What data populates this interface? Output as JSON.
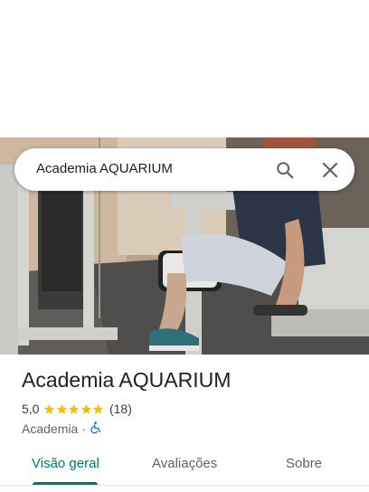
{
  "search": {
    "query": "Academia AQUARIUM"
  },
  "place": {
    "name": "Academia AQUARIUM",
    "rating": "5,0",
    "stars": 5,
    "review_count": "(18)",
    "category": "Academia",
    "separator": "·",
    "wheelchair_accessible": true
  },
  "tabs": [
    {
      "label": "Visão geral",
      "active": true
    },
    {
      "label": "Avaliações",
      "active": false
    },
    {
      "label": "Sobre",
      "active": false
    }
  ],
  "colors": {
    "accent": "#00796b",
    "star": "#fbbc04",
    "accessibility_icon": "#1a73e8"
  },
  "icons": {
    "search": "search-icon",
    "close": "close-icon",
    "accessibility": "wheelchair-icon",
    "star": "star-icon"
  }
}
